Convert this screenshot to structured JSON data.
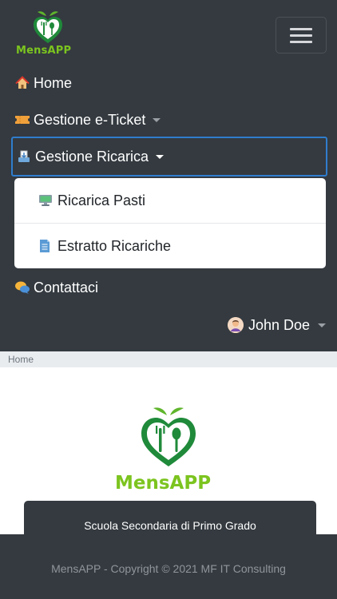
{
  "brand": {
    "name": "MensAPP"
  },
  "navbar": {
    "toggler_icon": "hamburger-icon",
    "items": [
      {
        "label": "Home",
        "icon": "house-icon",
        "dropdown": false
      },
      {
        "label": "Gestione e-Ticket",
        "icon": "ticket-icon",
        "dropdown": true
      },
      {
        "label": "Gestione Ricarica",
        "icon": "inbox-tray-icon",
        "dropdown": true,
        "expanded": true
      },
      {
        "label": "Contattaci",
        "icon": "speech-bubble-icon",
        "dropdown": false
      }
    ],
    "ricarica_menu": [
      {
        "label": "Ricarica Pasti",
        "icon": "computer-icon"
      },
      {
        "label": "Estratto Ricariche",
        "icon": "document-icon"
      }
    ],
    "user": {
      "name": "John Doe",
      "icon": "avatar-icon"
    }
  },
  "breadcrumb": {
    "current": "Home"
  },
  "main": {
    "logo_text": "MensAPP",
    "school_name": "Scuola Secondaria di Primo Grado"
  },
  "footer": {
    "text": "MensAPP - Copyright © 2021 MF IT Consulting"
  },
  "colors": {
    "navbar_bg": "#343a40",
    "brand_green": "#7cc41f",
    "logo_dark_green": "#1f8a3a",
    "leaf_green": "#5fb52c",
    "active_border": "#2f7dcd"
  }
}
